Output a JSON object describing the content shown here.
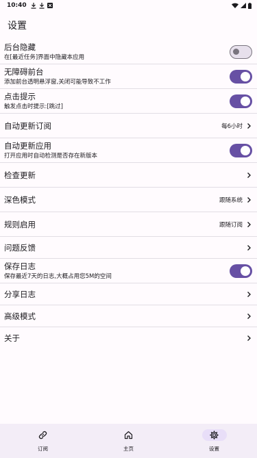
{
  "status_bar": {
    "time": "10:40"
  },
  "page_title": "设置",
  "items": [
    {
      "title": "后台隐藏",
      "sub": "在[最近任务]界面中隐藏本应用",
      "toggle": false
    },
    {
      "title": "无障碍前台",
      "sub": "添加前台透明悬浮窗,关闭可能导致不工作",
      "toggle": true
    },
    {
      "title": "点击提示",
      "sub": "触发点击时提示:[跳过]",
      "toggle": true
    },
    {
      "title": "自动更新订阅",
      "value": "每6小时"
    },
    {
      "title": "自动更新应用",
      "sub": "打开应用时自动检测是否存在新版本",
      "toggle": true
    },
    {
      "title": "检查更新"
    },
    {
      "title": "深色模式",
      "value": "跟随系统"
    },
    {
      "title": "规则启用",
      "value": "跟随订阅"
    },
    {
      "title": "问题反馈"
    },
    {
      "title": "保存日志",
      "sub": "保存最近7天的日志,大概占用您5M的空间",
      "toggle": true
    },
    {
      "title": "分享日志"
    },
    {
      "title": "高级模式"
    },
    {
      "title": "关于"
    }
  ],
  "bottom_nav": [
    {
      "label": "订阅",
      "icon": "link-icon"
    },
    {
      "label": "主页",
      "icon": "home-icon"
    },
    {
      "label": "设置",
      "icon": "settings-icon",
      "active": true
    }
  ]
}
